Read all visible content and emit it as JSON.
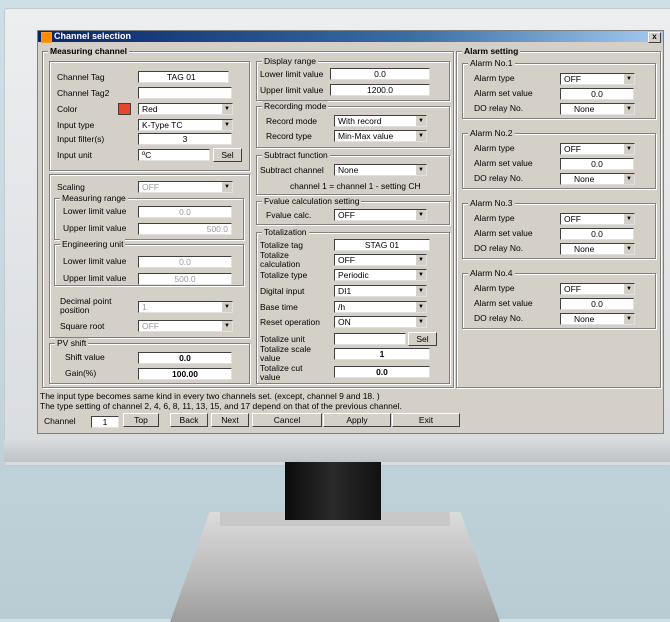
{
  "window": {
    "title": "Channel selection",
    "close": "x"
  },
  "measuring": {
    "heading": "Measuring channel",
    "channel_tag_label": "Channel Tag",
    "channel_tag": "TAG 01",
    "channel_tag2_label": "Channel Tag2",
    "channel_tag2": "",
    "color_label": "Color",
    "color": "Red",
    "color_hex": "#e8452c",
    "input_type_label": "Input type",
    "input_type": "K-Type TC",
    "input_filter_label": "Input filter(s)",
    "input_filter": "3",
    "input_unit_label": "Input unit",
    "input_unit": "ºC",
    "sel": "Sel",
    "scaling_label": "Scaling",
    "scaling": "OFF",
    "measuring_range_legend": "Measuring range",
    "mr_lower_label": "Lower limit value",
    "mr_lower": "0.0",
    "mr_upper_label": "Upper limit value",
    "mr_upper": "500.0",
    "eng_unit_legend": "Engineering unit",
    "eu_lower_label": "Lower limit value",
    "eu_lower": "0.0",
    "eu_upper_label": "Upper limit value",
    "eu_upper": "500.0",
    "decimal_label": "Decimal point position",
    "decimal": "1",
    "sqrt_label": "Square root",
    "sqrt": "OFF",
    "pv_shift_legend": "PV shift",
    "shift_label": "Shift value",
    "shift": "0.0",
    "gain_label": "Gain(%)",
    "gain": "100.00"
  },
  "display": {
    "legend": "Display range",
    "lower_label": "Lower limit value",
    "lower": "0.0",
    "upper_label": "Upper limit value",
    "upper": "1200.0"
  },
  "recording": {
    "legend": "Recording mode",
    "mode_label": "Record mode",
    "mode": "With record",
    "type_label": "Record type",
    "type": "Min-Max value"
  },
  "subtract": {
    "legend": "Subtract function",
    "channel_label": "Subtract channel",
    "channel": "None",
    "note": "channel 1 = channel 1 - setting CH"
  },
  "fvalue": {
    "legend": "Fvalue calculation setting",
    "calc_label": "Fvalue calc.",
    "calc": "OFF"
  },
  "totalization": {
    "legend": "Totalization",
    "tag_label": "Totalize tag",
    "tag": "STAG 01",
    "calc_label": "Totalize calculation",
    "calc": "OFF",
    "type_label": "Totalize type",
    "type": "Periodic",
    "din_label": "Digital input",
    "din": "DI1",
    "base_label": "Base time",
    "base": "/h",
    "reset_label": "Reset operation",
    "reset": "ON",
    "unit_label": "Totalize unit",
    "unit": "",
    "sel": "Sel",
    "scale_label": "Totalize scale value",
    "scale": "1",
    "cut_label": "Totalize cut value",
    "cut": "0.0"
  },
  "alarm": {
    "heading": "Alarm setting",
    "type_label": "Alarm type",
    "set_label": "Alarm set value",
    "relay_label": "DO relay No.",
    "items": [
      {
        "legend": "Alarm No.1",
        "type": "OFF",
        "set": "0.0",
        "relay": "None"
      },
      {
        "legend": "Alarm No.2",
        "type": "OFF",
        "set": "0.0",
        "relay": "None"
      },
      {
        "legend": "Alarm No.3",
        "type": "OFF",
        "set": "0.0",
        "relay": "None"
      },
      {
        "legend": "Alarm No.4",
        "type": "OFF",
        "set": "0.0",
        "relay": "None"
      }
    ]
  },
  "footer": {
    "note1": "The input type becomes same kind in every two channels set. (except, channel 9 and 18. )",
    "note2": "The type setting of channel 2, 4, 6, 8, 11, 13, 15, and 17 depend on that of the previous channel.",
    "channel_label": "Channel",
    "channel": "1",
    "top": "Top",
    "back": "Back",
    "next": "Next",
    "cancel": "Cancel",
    "apply": "Apply",
    "exit": "Exit"
  }
}
